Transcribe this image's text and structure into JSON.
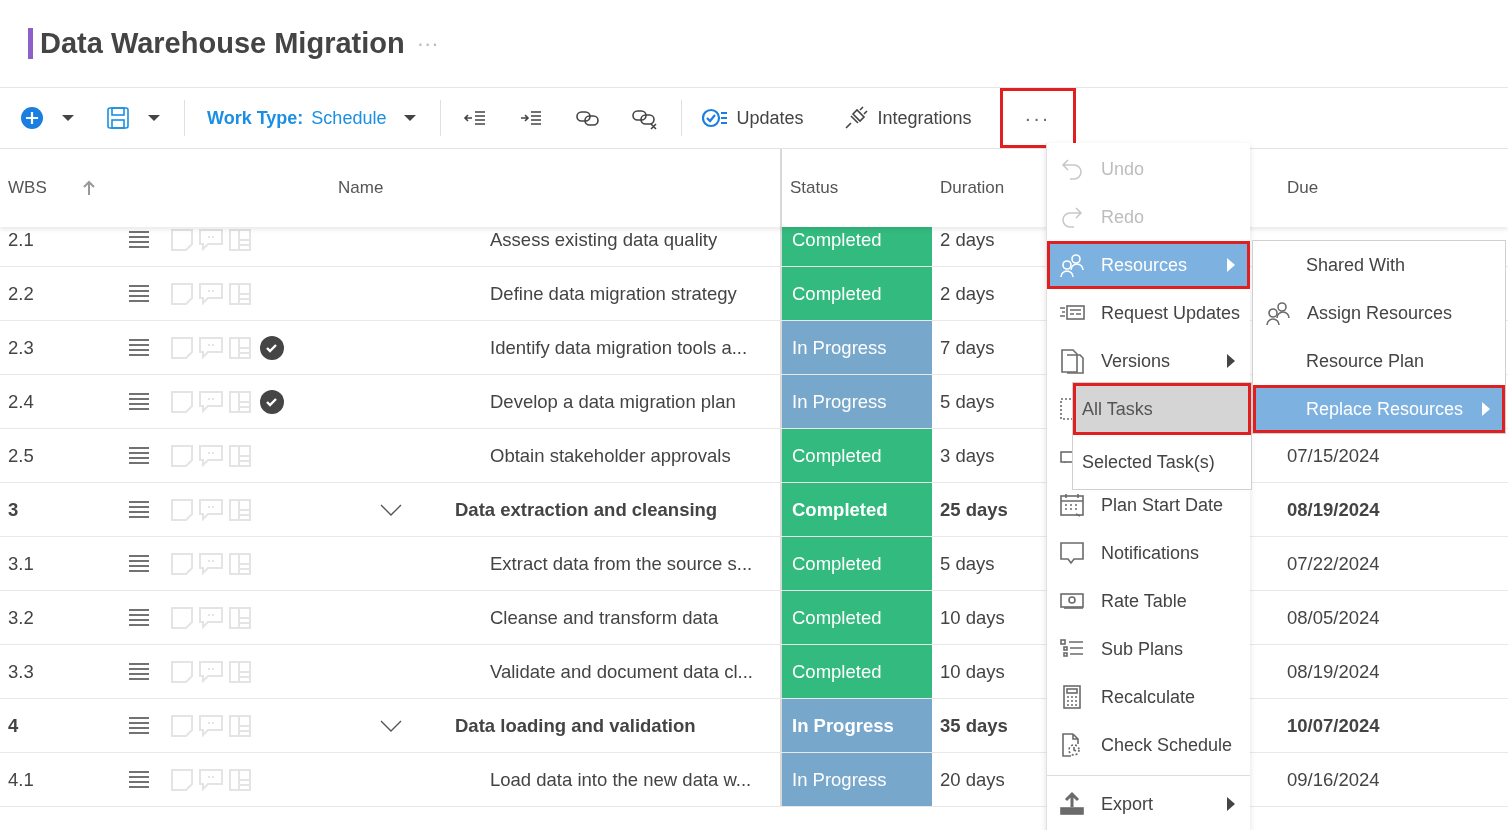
{
  "title": "Data Warehouse Migration",
  "title_more": "···",
  "toolbar": {
    "work_type": "**Work Type:** Schedule",
    "updates": "Updates",
    "integrations": "Integrations",
    "more": "···",
    "more_highlighted": true
  },
  "columns": [
    "WBS",
    "Name",
    "Status",
    "Duration",
    "Due"
  ],
  "rows": [
    {
      "wbs": "2.1",
      "kind": "task",
      "name": "Assess existing data quality",
      "checked": false,
      "status": "Completed",
      "color": "#33ba7e",
      "duration": "2 days"
    },
    {
      "wbs": "2.2",
      "kind": "task",
      "name": "Define data migration strategy",
      "checked": false,
      "status": "Completed",
      "color": "#33ba7e",
      "duration": "2 days"
    },
    {
      "wbs": "2.3",
      "kind": "task",
      "name": "Identify data migration tools a...",
      "checked": true,
      "status": "In Progress",
      "color": "#78a7cc",
      "duration": "7 days"
    },
    {
      "wbs": "2.4",
      "kind": "task",
      "name": "Develop a data migration plan",
      "checked": true,
      "status": "In Progress",
      "color": "#78a7cc",
      "duration": "5 days"
    },
    {
      "wbs": "2.5",
      "kind": "task",
      "name": "Obtain stakeholder approvals",
      "checked": false,
      "status": "Completed",
      "color": "#33ba7e",
      "duration": "3 days",
      "due": "07/15/2024"
    },
    {
      "wbs": "3",
      "kind": "summary",
      "expanded": true,
      "name": "Data extraction and cleansing",
      "checked": false,
      "status": "Completed",
      "color": "#33ba7e",
      "duration": "25 days",
      "due": "08/19/2024"
    },
    {
      "wbs": "3.1",
      "kind": "task",
      "name": "Extract data from the source s...",
      "checked": false,
      "status": "Completed",
      "color": "#33ba7e",
      "duration": "5 days",
      "due": "07/22/2024"
    },
    {
      "wbs": "3.2",
      "kind": "task",
      "name": "Cleanse and transform data",
      "checked": false,
      "status": "Completed",
      "color": "#33ba7e",
      "duration": "10 days",
      "due": "08/05/2024"
    },
    {
      "wbs": "3.3",
      "kind": "task",
      "name": "Validate and document data cl...",
      "checked": false,
      "status": "Completed",
      "color": "#33ba7e",
      "duration": "10 days",
      "due": "08/19/2024"
    },
    {
      "wbs": "4",
      "kind": "summary",
      "expanded": true,
      "name": "Data loading and validation",
      "checked": false,
      "status": "In Progress",
      "color": "#78a7cc",
      "duration": "35 days",
      "due": "10/07/2024"
    },
    {
      "wbs": "4.1",
      "kind": "task",
      "name": "Load data into the new data w...",
      "checked": false,
      "status": "In Progress",
      "color": "#78a7cc",
      "duration": "20 days",
      "due": "09/16/2024"
    }
  ],
  "menu": {
    "items": [
      {
        "kind": "item",
        "label": "Undo",
        "disabled": true,
        "selected": false,
        "submenu": false,
        "highlighted": false
      },
      {
        "kind": "item",
        "label": "Redo",
        "disabled": true,
        "selected": false,
        "submenu": false,
        "highlighted": false
      },
      {
        "kind": "item",
        "label": "Resources",
        "disabled": false,
        "selected": true,
        "submenu": true,
        "highlighted": true
      },
      {
        "kind": "item",
        "label": "Request Updates",
        "disabled": false,
        "selected": false,
        "submenu": false,
        "highlighted": false
      },
      {
        "kind": "item",
        "label": "Versions",
        "disabled": false,
        "selected": false,
        "submenu": true,
        "highlighted": false
      },
      {
        "kind": "covered"
      },
      {
        "kind": "covered"
      },
      {
        "kind": "item",
        "label": "Plan Start Date",
        "disabled": false,
        "selected": false,
        "submenu": false,
        "highlighted": false
      },
      {
        "kind": "item",
        "label": "Notifications",
        "disabled": false,
        "selected": false,
        "submenu": false,
        "highlighted": false
      },
      {
        "kind": "item",
        "label": "Rate Table",
        "disabled": false,
        "selected": false,
        "submenu": false,
        "highlighted": false
      },
      {
        "kind": "item",
        "label": "Sub Plans",
        "disabled": false,
        "selected": false,
        "submenu": false,
        "highlighted": false
      },
      {
        "kind": "item",
        "label": "Recalculate",
        "disabled": false,
        "selected": false,
        "submenu": false,
        "highlighted": false
      },
      {
        "kind": "item",
        "label": "Check Schedule",
        "disabled": false,
        "selected": false,
        "submenu": false,
        "highlighted": false
      },
      {
        "kind": "divider"
      },
      {
        "kind": "item",
        "label": "Export",
        "disabled": false,
        "selected": false,
        "submenu": true,
        "highlighted": false
      }
    ]
  },
  "versions_submenu": {
    "items": [
      {
        "label": "All Tasks",
        "hovered": true,
        "highlighted": true
      },
      {
        "label": "Selected Task(s)",
        "hovered": false,
        "highlighted": false
      }
    ]
  },
  "resources_submenu": {
    "items": [
      {
        "label": "Shared With",
        "selected": false,
        "submenu": false,
        "highlighted": false
      },
      {
        "label": "Assign Resources",
        "selected": false,
        "submenu": false,
        "highlighted": false
      },
      {
        "label": "Resource Plan",
        "selected": false,
        "submenu": false,
        "highlighted": false
      },
      {
        "label": "Replace Resources",
        "selected": true,
        "submenu": true,
        "highlighted": true
      }
    ]
  }
}
